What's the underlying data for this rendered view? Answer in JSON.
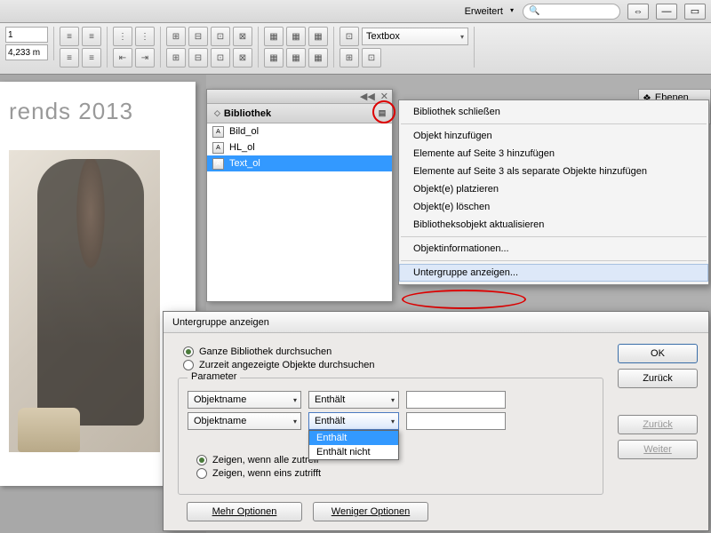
{
  "topbar": {
    "workspace": "Erweitert"
  },
  "toolbar": {
    "num_field": "1",
    "measure_field": "4,233 m",
    "combo_label": "Textbox"
  },
  "canvas": {
    "title": "rends 2013"
  },
  "library_panel": {
    "title": "Bibliothek",
    "items": [
      {
        "name": "Bild_ol",
        "selected": false
      },
      {
        "name": "HL_ol",
        "selected": false
      },
      {
        "name": "Text_ol",
        "selected": true
      }
    ]
  },
  "right_dock": {
    "tab": "Ebenen"
  },
  "context_menu": {
    "items": [
      "Bibliothek schließen",
      "-",
      "Objekt hinzufügen",
      "Elemente auf Seite 3 hinzufügen",
      "Elemente auf Seite 3 als separate Objekte hinzufügen",
      "Objekt(e) platzieren",
      "Objekt(e) löschen",
      "Bibliotheksobjekt aktualisieren",
      "-",
      "Objektinformationen...",
      "-",
      "Untergruppe anzeigen..."
    ],
    "highlighted_index": 11
  },
  "dialog": {
    "title": "Untergruppe anzeigen",
    "scope": {
      "all_label": "Ganze Bibliothek durchsuchen",
      "current_label": "Zurzeit angezeigte Objekte durchsuchen",
      "selected": "all"
    },
    "fieldset_legend": "Parameter",
    "rows": [
      {
        "field": "Objektname",
        "op": "Enthält",
        "value": ""
      },
      {
        "field": "Objektname",
        "op": "Enthält",
        "value": ""
      }
    ],
    "op_options": [
      "Enthält",
      "Enthält nicht"
    ],
    "match": {
      "all_label": "Zeigen, wenn alle zutreff",
      "any_label": "Zeigen, wenn eins zutrifft",
      "selected": "all"
    },
    "buttons": {
      "ok": "OK",
      "back": "Zurück",
      "prev": "Zurück",
      "next": "Weiter",
      "more": "Mehr Optionen",
      "fewer": "Weniger Optionen"
    }
  }
}
